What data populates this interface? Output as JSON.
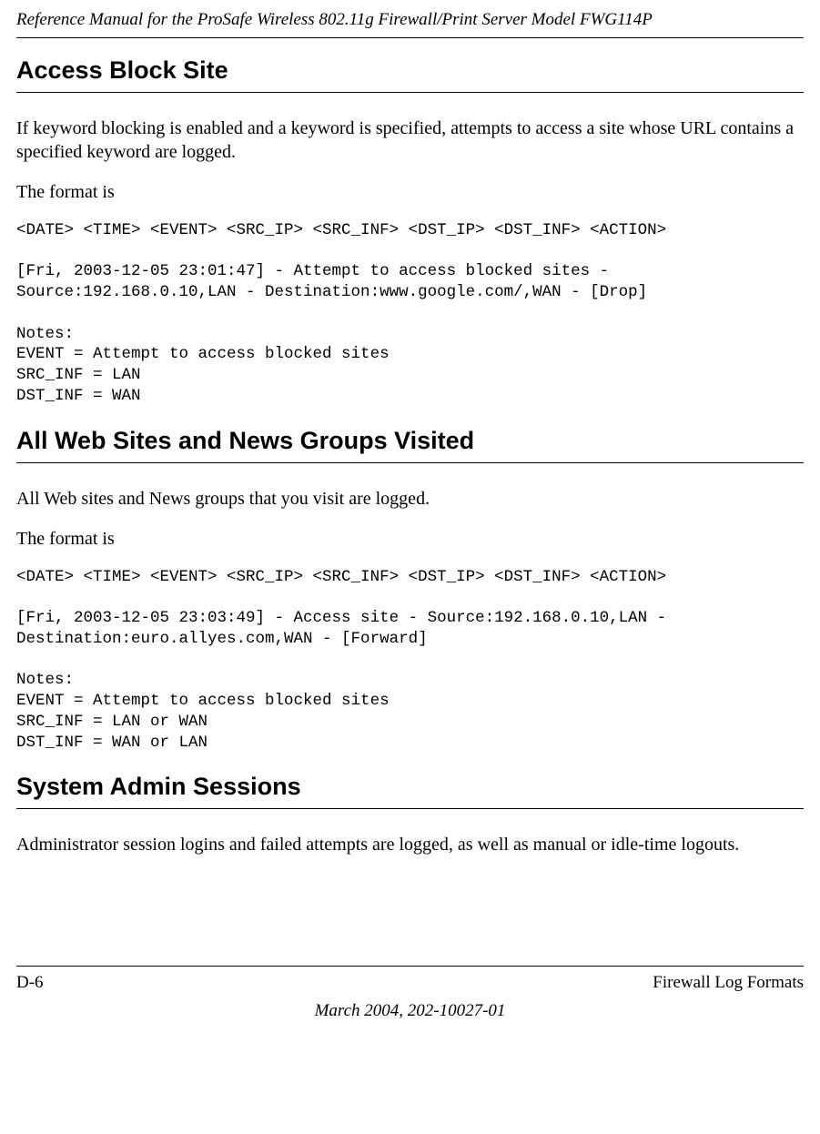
{
  "header": {
    "running_title": "Reference Manual for the ProSafe Wireless 802.11g  Firewall/Print Server Model FWG114P"
  },
  "sections": {
    "s1": {
      "heading": "Access Block Site",
      "p1": "If keyword blocking is enabled and a keyword is specified, attempts to access a site whose URL contains a specified keyword are logged.",
      "p2": "The format is",
      "code": "<DATE> <TIME> <EVENT> <SRC_IP> <SRC_INF> <DST_IP> <DST_INF> <ACTION>\n\n[Fri, 2003-12-05 23:01:47] - Attempt to access blocked sites - Source:192.168.0.10,LAN - Destination:www.google.com/,WAN - [Drop]\n\nNotes:\nEVENT = Attempt to access blocked sites\nSRC_INF = LAN\nDST_INF = WAN"
    },
    "s2": {
      "heading": "All Web Sites and News Groups Visited",
      "p1": "All Web sites and News groups that you visit are logged.",
      "p2": "The format is",
      "code": "<DATE> <TIME> <EVENT> <SRC_IP> <SRC_INF> <DST_IP> <DST_INF> <ACTION>\n\n[Fri, 2003-12-05 23:03:49] - Access site - Source:192.168.0.10,LAN - Destination:euro.allyes.com,WAN - [Forward]\n\nNotes:\nEVENT = Attempt to access blocked sites\nSRC_INF = LAN or WAN\nDST_INF = WAN or LAN"
    },
    "s3": {
      "heading": "System Admin Sessions",
      "p1": "Administrator session logins and failed attempts are logged, as well as manual or idle-time logouts."
    }
  },
  "footer": {
    "page_num": "D-6",
    "section_title": "Firewall Log Formats",
    "doc_info": "March 2004, 202-10027-01"
  }
}
